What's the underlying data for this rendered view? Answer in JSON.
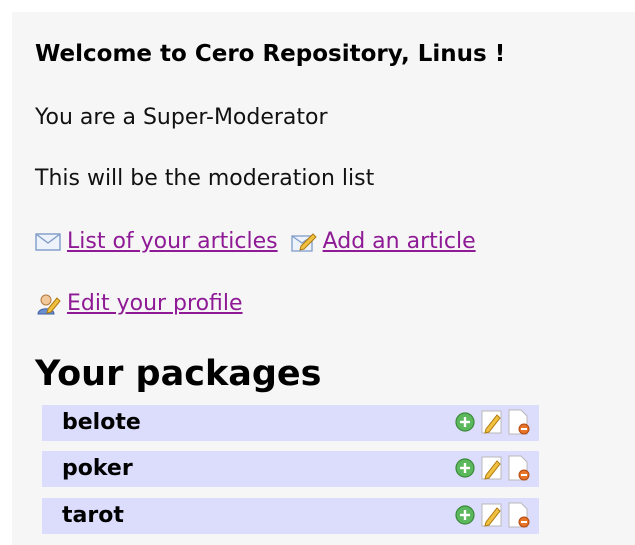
{
  "header": {
    "welcome": "Welcome to Cero Repository, Linus !"
  },
  "status": {
    "role": "You are a Super-Moderator",
    "moderation": "This will be the moderation list"
  },
  "links": {
    "articles": {
      "label": "List of your articles",
      "icon": "envelope-icon"
    },
    "add_article": {
      "label": "Add an article",
      "icon": "edit-note-icon"
    },
    "profile": {
      "label": "Edit your profile",
      "icon": "user-edit-icon"
    }
  },
  "packages": {
    "title": "Your packages",
    "row_color": "#dcdcfc",
    "items": [
      {
        "name": "belote"
      },
      {
        "name": "poker"
      },
      {
        "name": "tarot"
      }
    ],
    "action_icons": [
      "add-icon",
      "edit-icon",
      "delete-icon"
    ]
  },
  "colors": {
    "link": "#8e1a95",
    "panel": "#f6f6f6"
  }
}
